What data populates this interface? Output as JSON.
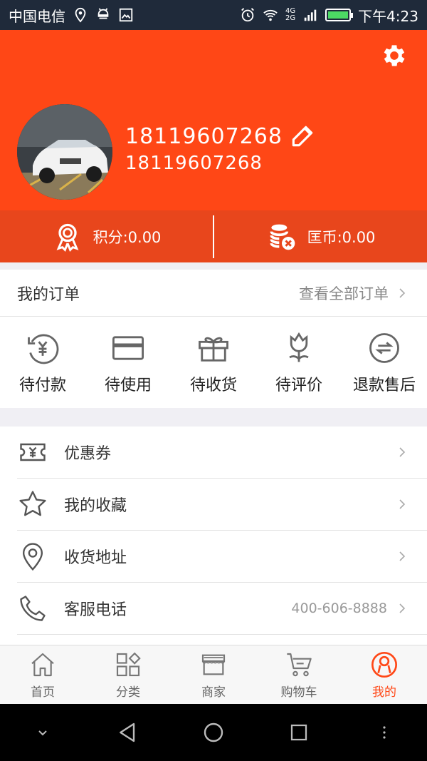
{
  "status_bar": {
    "carrier": "中国电信",
    "network_top": "4G",
    "network_bottom": "2G",
    "time": "下午4:23"
  },
  "profile": {
    "name": "18119607268",
    "phone": "18119607268",
    "points_label": "积分:0.00",
    "coins_label": "匡币:0.00"
  },
  "orders": {
    "title": "我的订单",
    "view_all": "查看全部订单",
    "items": [
      {
        "label": "待付款",
        "icon": "pending-payment-icon"
      },
      {
        "label": "待使用",
        "icon": "card-icon"
      },
      {
        "label": "待收货",
        "icon": "gift-box-icon"
      },
      {
        "label": "待评价",
        "icon": "tulip-icon"
      },
      {
        "label": "退款售后",
        "icon": "refund-icon"
      }
    ]
  },
  "menu": [
    {
      "label": "优惠券",
      "icon": "coupon-icon",
      "value": ""
    },
    {
      "label": "我的收藏",
      "icon": "star-icon",
      "value": ""
    },
    {
      "label": "收货地址",
      "icon": "location-pin-icon",
      "value": ""
    },
    {
      "label": "客服电话",
      "icon": "phone-icon",
      "value": "400-606-8888"
    }
  ],
  "tabs": [
    {
      "label": "首页",
      "icon": "home-icon",
      "active": false
    },
    {
      "label": "分类",
      "icon": "category-icon",
      "active": false
    },
    {
      "label": "商家",
      "icon": "store-icon",
      "active": false
    },
    {
      "label": "购物车",
      "icon": "cart-icon",
      "active": false
    },
    {
      "label": "我的",
      "icon": "profile-icon",
      "active": true
    }
  ],
  "colors": {
    "brand": "#ff4716",
    "points_bar": "#e8461c",
    "status_bar": "#1f2a3a"
  }
}
